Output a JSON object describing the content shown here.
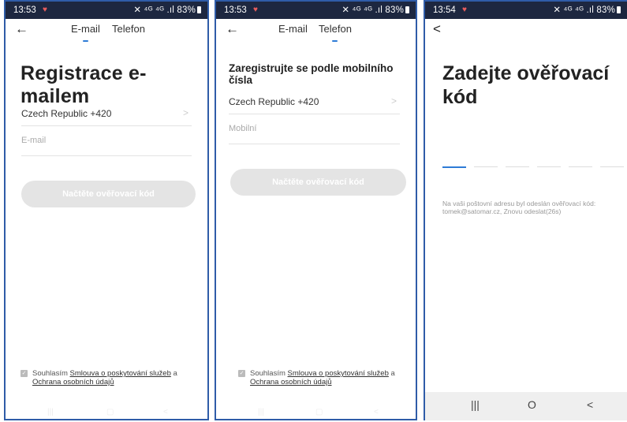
{
  "screen1": {
    "status": {
      "time": "13:53",
      "icons": "✕ ⁴ᴳ ⁴ᴳ .ıl 83%"
    },
    "tabs": {
      "email": "E-mail",
      "phone": "Telefon"
    },
    "title": "Registrace e-mailem",
    "country": "Czech Republic +420",
    "email_placeholder": "E-mail",
    "button": "Načtěte ověřovací kód",
    "agree_prefix": "Souhlasím ",
    "agree_link1": "Smlouva o poskytování služeb",
    "agree_mid": " a ",
    "agree_link2": "Ochrana osobních údajů"
  },
  "screen2": {
    "status": {
      "time": "13:53",
      "icons": "✕ ⁴ᴳ ⁴ᴳ .ıl 83%"
    },
    "tabs": {
      "email": "E-mail",
      "phone": "Telefon"
    },
    "title": "Zaregistrujte se podle mobilního čísla",
    "country": "Czech Republic +420",
    "mobile_placeholder": "Mobilní",
    "button": "Načtěte ověřovací kód",
    "agree_prefix": "Souhlasím ",
    "agree_link1": "Smlouva o poskytování služeb",
    "agree_mid": " a ",
    "agree_link2": "Ochrana osobních údajů"
  },
  "screen3": {
    "status": {
      "time": "13:54",
      "icons": "✕ ⁴ᴳ ⁴ᴳ .ıl 83%"
    },
    "title": "Zadejte ověřovací kód",
    "info": "Na vaši poštovní adresu byl odeslán ověřovací kód: tomek@satomar.cz, Znovu odeslat(26s)"
  },
  "icons": {
    "back": "arrow-left",
    "back_chevron": "chevron-left",
    "heart": "heart",
    "chevron": "chevron-right",
    "check": "check",
    "recents": "|||",
    "home": "O",
    "nav_back": "<"
  },
  "colors": {
    "frame_border": "#2f5ca8",
    "status_bg": "#1d2740",
    "accent": "#2e7bd6",
    "button_disabled": "#e4e4e4"
  }
}
